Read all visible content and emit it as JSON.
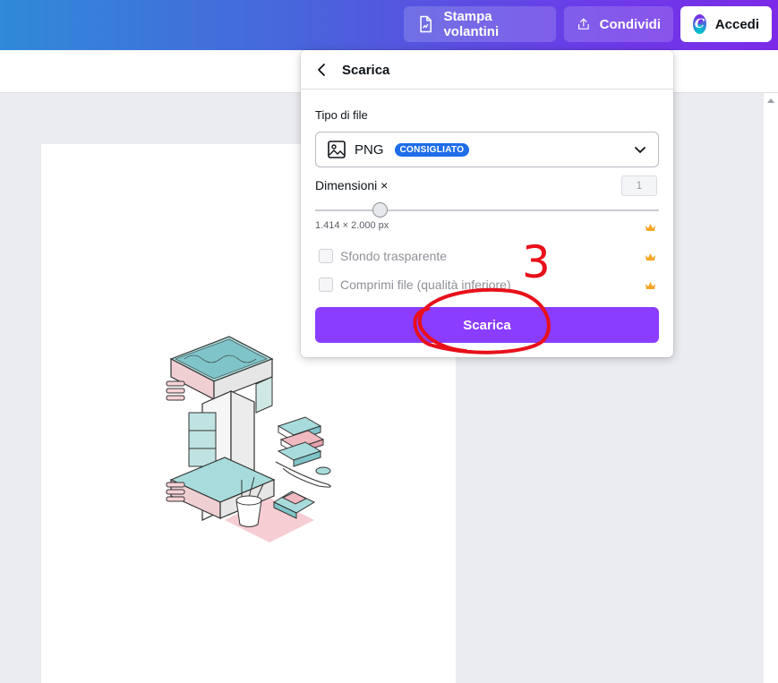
{
  "topbar": {
    "print_label": "Stampa volantini",
    "share_label": "Condividi",
    "login_label": "Accedi",
    "logo_letter": "C"
  },
  "download_panel": {
    "title": "Scarica",
    "file_type_label": "Tipo di file",
    "file_type_value": "PNG",
    "badge": "CONSIGLIATO",
    "dimensions_label": "Dimensioni ×",
    "dimensions_value": "1",
    "dimensions_readout": "1.414 × 2.000 px",
    "option_transparent": "Sfondo trasparente",
    "option_compress": "Comprimi file (qualità inferiore)",
    "download_button": "Scarica"
  },
  "annotation": {
    "step_number": "3"
  },
  "colors": {
    "accent": "#8b3dff",
    "badge": "#1f6de8",
    "annotation": "#e8101a",
    "crown": "#f5a623"
  }
}
